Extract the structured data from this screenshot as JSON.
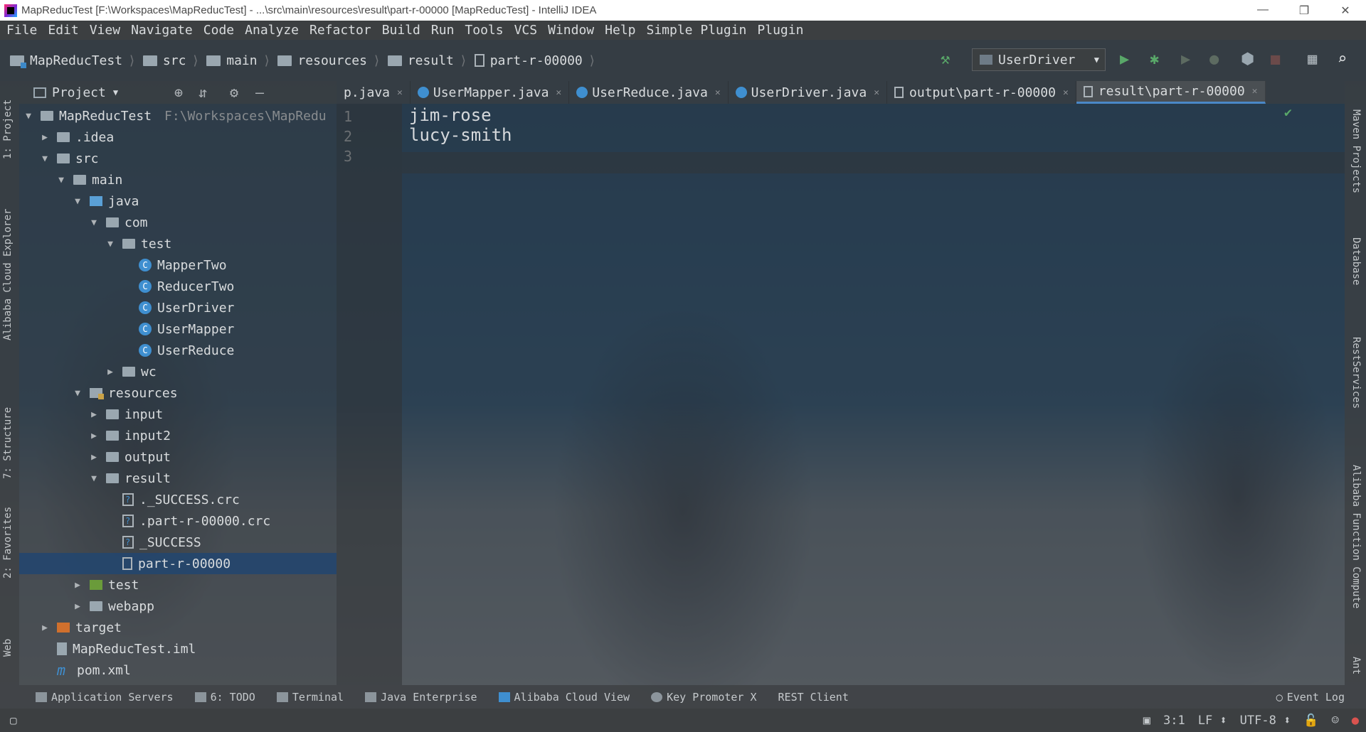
{
  "window": {
    "title": "MapReducTest [F:\\Workspaces\\MapReducTest] - ...\\src\\main\\resources\\result\\part-r-00000 [MapReducTest] - IntelliJ IDEA",
    "minimize": "—",
    "restore": "❐",
    "close": "✕"
  },
  "menu": [
    "File",
    "Edit",
    "View",
    "Navigate",
    "Code",
    "Analyze",
    "Refactor",
    "Build",
    "Run",
    "Tools",
    "VCS",
    "Window",
    "Help",
    "Simple Plugin",
    "Plugin"
  ],
  "breadcrumb": [
    "MapReducTest",
    "src",
    "main",
    "resources",
    "result",
    "part-r-00000"
  ],
  "run_config": "UserDriver",
  "left_tool_tabs": [
    "1: Project",
    "Alibaba Cloud Explorer",
    "7: Structure",
    "2: Favorites",
    "Web"
  ],
  "right_tool_tabs": [
    "Maven Projects",
    "Database",
    "RestServices",
    "Alibaba Function Compute",
    "Ant"
  ],
  "project_panel": {
    "title": "Project",
    "root_path": "F:\\Workspaces\\MapRedu",
    "tree": [
      {
        "label": "MapReducTest",
        "arrow": "▼",
        "icon": "module",
        "indent": 0
      },
      {
        "label": ".idea",
        "arrow": "▶",
        "icon": "folder",
        "indent": 1
      },
      {
        "label": "src",
        "arrow": "▼",
        "icon": "folder",
        "indent": 1
      },
      {
        "label": "main",
        "arrow": "▼",
        "icon": "folder",
        "indent": 2
      },
      {
        "label": "java",
        "arrow": "▼",
        "icon": "folder-blue",
        "indent": 3
      },
      {
        "label": "com",
        "arrow": "▼",
        "icon": "folder",
        "indent": 4
      },
      {
        "label": "test",
        "arrow": "▼",
        "icon": "folder",
        "indent": 5
      },
      {
        "label": "MapperTwo",
        "arrow": "",
        "icon": "class",
        "indent": 6
      },
      {
        "label": "ReducerTwo",
        "arrow": "",
        "icon": "class",
        "indent": 6
      },
      {
        "label": "UserDriver",
        "arrow": "",
        "icon": "class",
        "indent": 6
      },
      {
        "label": "UserMapper",
        "arrow": "",
        "icon": "class",
        "indent": 6
      },
      {
        "label": "UserReduce",
        "arrow": "",
        "icon": "class",
        "indent": 6
      },
      {
        "label": "wc",
        "arrow": "▶",
        "icon": "folder",
        "indent": 5
      },
      {
        "label": "resources",
        "arrow": "▼",
        "icon": "folder-res",
        "indent": 3
      },
      {
        "label": "input",
        "arrow": "▶",
        "icon": "folder",
        "indent": 4
      },
      {
        "label": "input2",
        "arrow": "▶",
        "icon": "folder",
        "indent": 4
      },
      {
        "label": "output",
        "arrow": "▶",
        "icon": "folder",
        "indent": 4
      },
      {
        "label": "result",
        "arrow": "▼",
        "icon": "folder",
        "indent": 4
      },
      {
        "label": "._SUCCESS.crc",
        "arrow": "",
        "icon": "unknown",
        "indent": 5
      },
      {
        "label": ".part-r-00000.crc",
        "arrow": "",
        "icon": "unknown",
        "indent": 5
      },
      {
        "label": "_SUCCESS",
        "arrow": "",
        "icon": "unknown",
        "indent": 5
      },
      {
        "label": "part-r-00000",
        "arrow": "",
        "icon": "file",
        "indent": 5,
        "selected": true
      },
      {
        "label": "test",
        "arrow": "▶",
        "icon": "folder-green",
        "indent": 3
      },
      {
        "label": "webapp",
        "arrow": "▶",
        "icon": "folder",
        "indent": 3
      },
      {
        "label": "target",
        "arrow": "▶",
        "icon": "folder-orange",
        "indent": 1
      },
      {
        "label": "MapReducTest.iml",
        "arrow": "",
        "icon": "iml",
        "indent": 1
      },
      {
        "label": "pom.xml",
        "arrow": "",
        "icon": "maven",
        "indent": 1
      }
    ]
  },
  "editor_tabs": [
    {
      "label": "p.java",
      "icon": "class"
    },
    {
      "label": "UserMapper.java",
      "icon": "class"
    },
    {
      "label": "UserReduce.java",
      "icon": "class"
    },
    {
      "label": "UserDriver.java",
      "icon": "class"
    },
    {
      "label": "output\\part-r-00000",
      "icon": "file"
    },
    {
      "label": "result\\part-r-00000",
      "icon": "file",
      "active": true
    }
  ],
  "editor": {
    "line_numbers": [
      "1",
      "2",
      "3"
    ],
    "lines": [
      "jim-rose",
      "lucy-smith",
      ""
    ]
  },
  "bottom_tools": [
    "Application Servers",
    "6: TODO",
    "Terminal",
    "Java Enterprise",
    "Alibaba Cloud View",
    "Key Promoter X",
    "REST Client"
  ],
  "event_log": "Event Log",
  "status": {
    "position": "3:1",
    "line_sep": "LF ⬍",
    "encoding": "UTF-8 ⬍"
  },
  "colors": {
    "accent": "#4a88c7",
    "selection": "#24466e",
    "run_green": "#59a869"
  }
}
